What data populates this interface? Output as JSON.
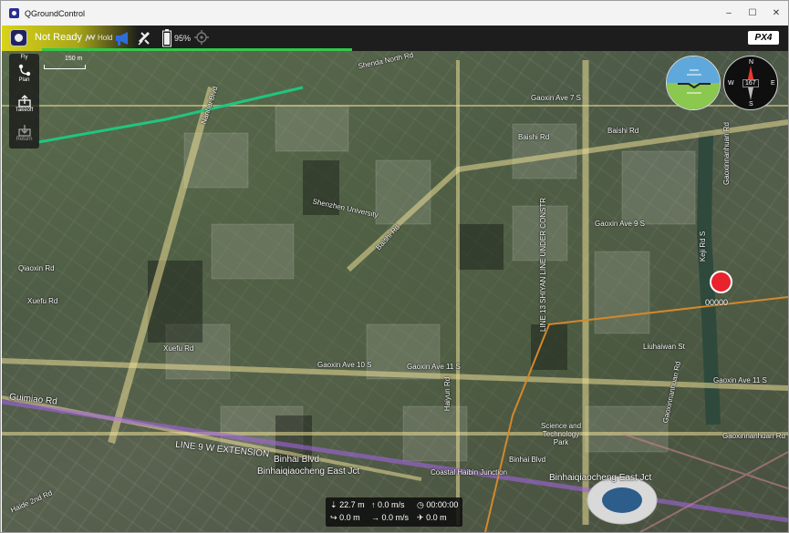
{
  "window": {
    "title": "QGroundControl",
    "controls": [
      "–",
      "☐",
      "✕"
    ]
  },
  "toolbar": {
    "status": "Not Ready",
    "flight_mode": "Hold",
    "battery": "95%",
    "brand": "PX4",
    "accent_color": "#d8d318",
    "progress_color": "#31c84a"
  },
  "left_tools": [
    {
      "label": "Fly",
      "icon": "fly-icon"
    },
    {
      "label": "Plan",
      "icon": "plan-icon"
    },
    {
      "label": "Takeoff",
      "icon": "takeoff-icon"
    },
    {
      "label": "Return",
      "icon": "return-icon"
    }
  ],
  "map": {
    "scale_label": "150 m",
    "roads": [
      "Shenda North Rd",
      "Nanhai Blvd",
      "Baishi Rd",
      "Baishi Rd",
      "Shenzhen University",
      "Baishi Rd",
      "Gaoxin Ave 7 S",
      "Gaoxin Ave 9 S",
      "Gaoxin Ave 10 S",
      "Gaoxin Ave 11 S",
      "Gaoxin Ave 11 S",
      "Xuefu Rd",
      "Xuefu Rd",
      "Qiaoxin Rd",
      "Guimiao Rd",
      "Binhai Blvd",
      "Binhai Blvd",
      "Binhaiqiaocheng East Jct",
      "Binhaiqiaocheng East Jct",
      "Coastal Haibin Junction",
      "LINE 9 W EXTENSION",
      "LINE 13 SHIYAN LINE UNDER CONSTR",
      "Gaoxinnanhuan Rd",
      "Gaoxinnanhuan Rd",
      "Gaoxinnanhuan Rd",
      "Keji Rd S",
      "Haiyun Rd",
      "Science and Technology Park",
      "Liuhaiwan St",
      "Haide 2nd Rd"
    ]
  },
  "instruments": {
    "heading": "167",
    "compass_labels": [
      "N",
      "E",
      "S",
      "W"
    ]
  },
  "video": {
    "record_time": "00000"
  },
  "telemetry": {
    "altitude": "22.7 m",
    "vertical_speed": "0.0 m/s",
    "flight_time": "00:00:00",
    "horizontal_distance": "0.0 m",
    "horizontal_speed": "0.0 m/s",
    "distance_to_home": "0.0 m"
  }
}
